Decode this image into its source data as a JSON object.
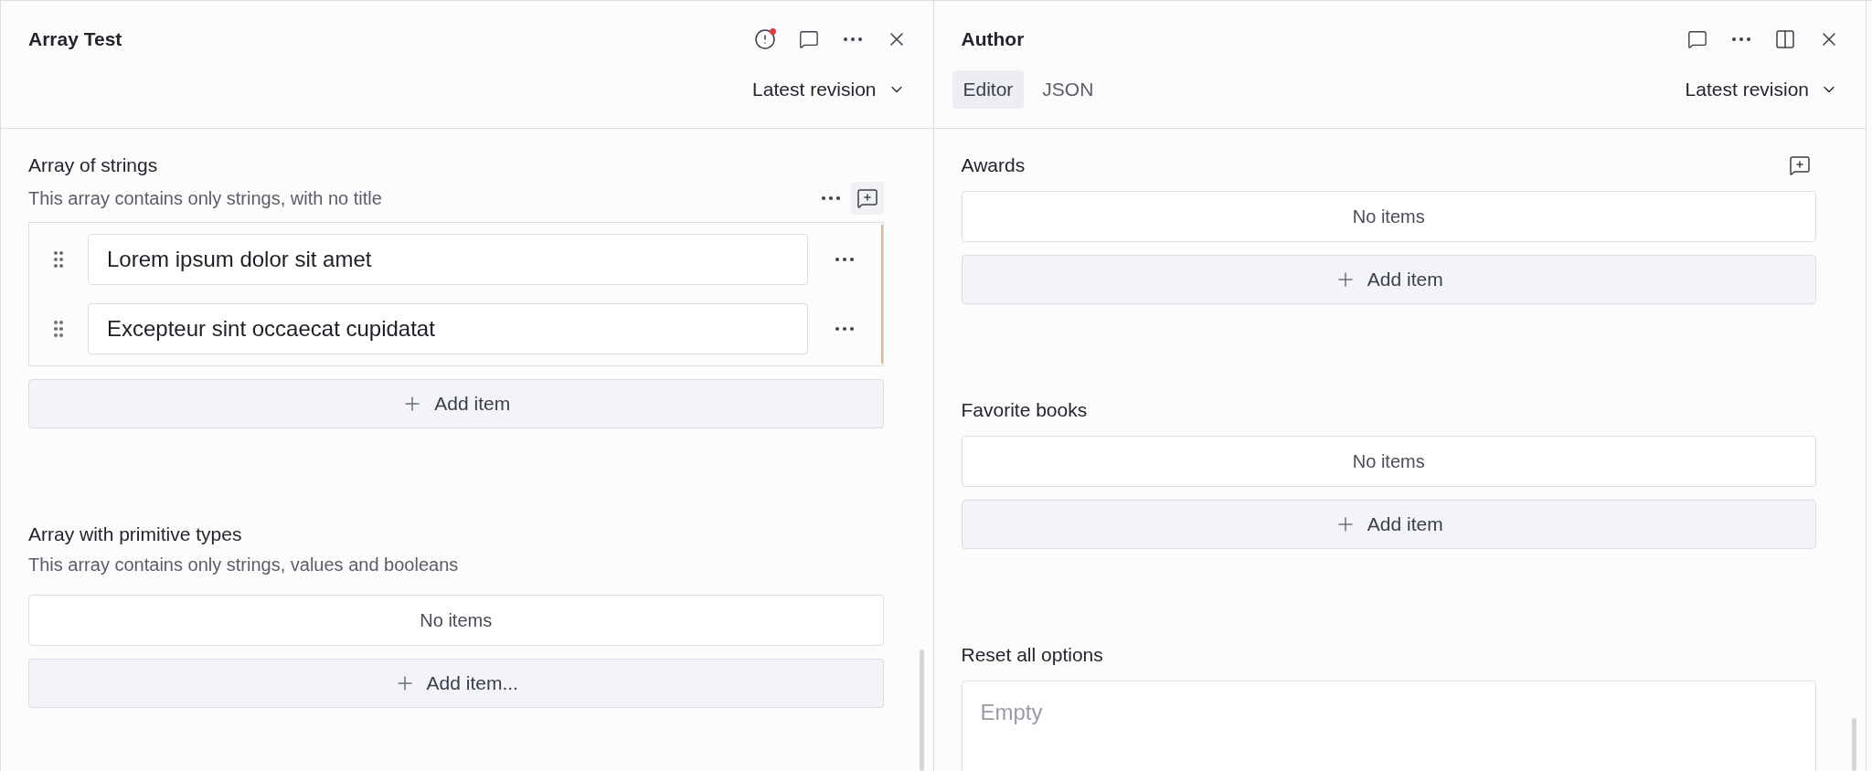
{
  "panes": [
    {
      "title": "Array Test",
      "revision": "Latest revision",
      "header_icons": [
        {
          "kind": "alert",
          "alert_dot": true
        },
        {
          "kind": "comment"
        },
        {
          "kind": "more"
        },
        {
          "kind": "close"
        }
      ],
      "sections": [
        {
          "kind": "array",
          "title": "Array of strings",
          "description": "This array contains only strings, with no title",
          "hovered": true,
          "items": [
            {
              "value": "Lorem ipsum dolor sit amet",
              "changed": true
            },
            {
              "value": "Excepteur sint occaecat cupidatat",
              "changed": true
            }
          ],
          "add_label": "Add item"
        },
        {
          "kind": "empty_array",
          "title": "Array with primitive types",
          "description": "This array contains only strings, values and booleans",
          "empty_label": "No items",
          "add_label": "Add item..."
        }
      ]
    },
    {
      "title": "Author",
      "tabs": [
        {
          "label": "Editor",
          "selected": true
        },
        {
          "label": "JSON",
          "selected": false
        }
      ],
      "revision": "Latest revision",
      "header_icons": [
        {
          "kind": "comment"
        },
        {
          "kind": "more"
        },
        {
          "kind": "split"
        },
        {
          "kind": "close"
        }
      ],
      "sections": [
        {
          "kind": "empty_array",
          "title": "Awards",
          "comment_icon": true,
          "empty_label": "No items",
          "add_label": "Add item"
        },
        {
          "kind": "empty_array",
          "title": "Favorite books",
          "empty_label": "No items",
          "add_label": "Add item"
        },
        {
          "kind": "text",
          "title": "Reset all options",
          "placeholder": "Empty"
        }
      ]
    }
  ]
}
